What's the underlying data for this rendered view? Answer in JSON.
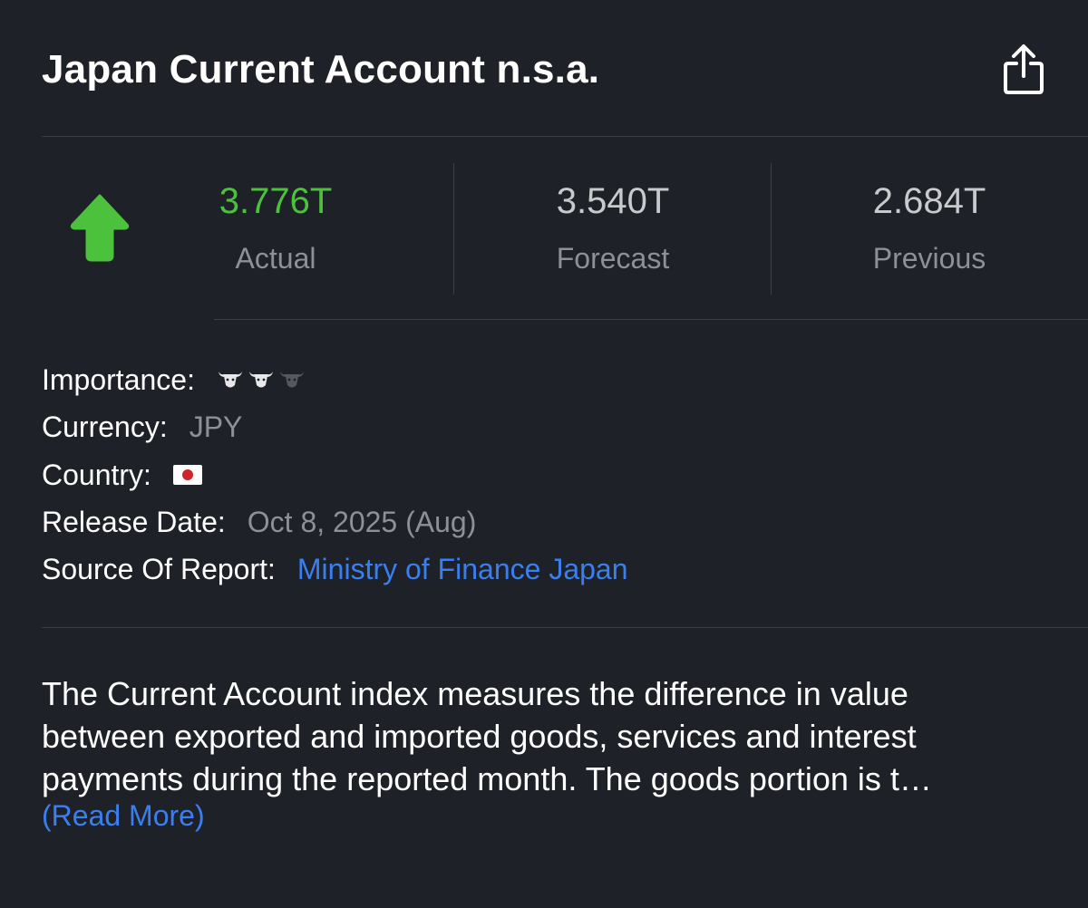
{
  "header": {
    "title": "Japan Current Account n.s.a.",
    "share_icon": "share-icon"
  },
  "stats": {
    "direction_icon": "up-arrow-icon",
    "direction_color": "#4cc23c",
    "actual": {
      "value": "3.776T",
      "label": "Actual"
    },
    "forecast": {
      "value": "3.540T",
      "label": "Forecast"
    },
    "previous": {
      "value": "2.684T",
      "label": "Previous"
    }
  },
  "details": {
    "importance_label": "Importance:",
    "importance_level": 2,
    "importance_max": 3,
    "importance_icon": "bull-icon",
    "currency_label": "Currency:",
    "currency_value": "JPY",
    "country_label": "Country:",
    "country_icon": "japan-flag-icon",
    "release_label": "Release Date:",
    "release_value": "Oct 8, 2025 (Aug)",
    "source_label": "Source Of Report:",
    "source_value": "Ministry of Finance Japan"
  },
  "description": {
    "lines": [
      "The Current Account index measures the difference in value",
      "between exported and imported goods, services and interest",
      "payments during the reported month. The goods portion is t…"
    ],
    "read_more": "(Read More)"
  },
  "colors": {
    "background": "#1e2127",
    "positive": "#4cc23c",
    "link": "#3a7ff0",
    "muted": "#8d9096"
  }
}
